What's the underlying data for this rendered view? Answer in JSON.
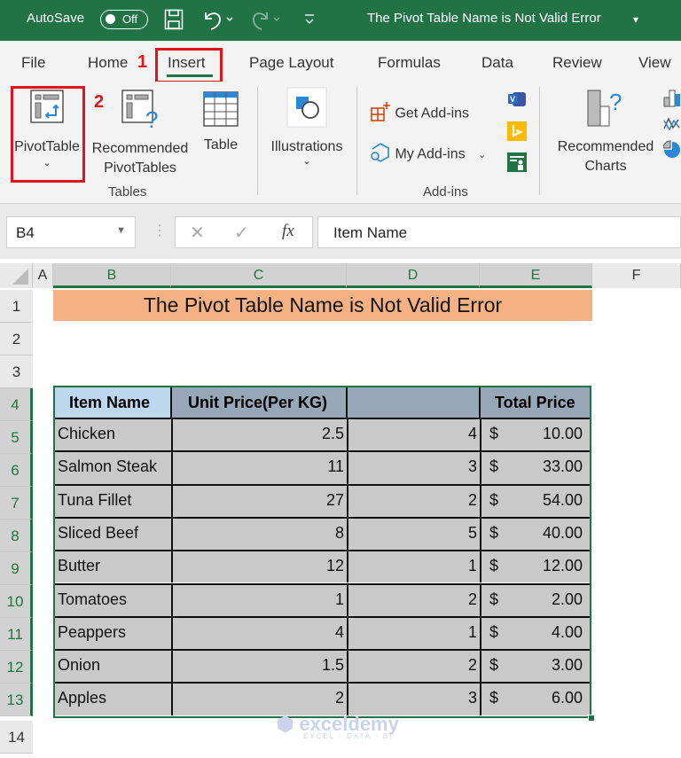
{
  "titlebar": {
    "autosave_label": "AutoSave",
    "autosave_state": "Off",
    "document_title": "The Pivot Table Name is Not Valid Error",
    "title_dropdown": "▾"
  },
  "ribbon_tabs": [
    "File",
    "Home",
    "Insert",
    "Page Layout",
    "Formulas",
    "Data",
    "Review",
    "View"
  ],
  "active_tab": "Insert",
  "annotations": {
    "step1": "1",
    "step2": "2"
  },
  "ribbon": {
    "pivot_table": "PivotTable",
    "recommended_pivot_line1": "Recommended",
    "recommended_pivot_line2": "PivotTables",
    "table": "Table",
    "tables_group": "Tables",
    "illustrations": "Illustrations",
    "get_addins": "Get Add-ins",
    "my_addins": "My Add-ins",
    "addins_group": "Add-ins",
    "recommended_charts_line1": "Recommended",
    "recommended_charts_line2": "Charts"
  },
  "formula_bar": {
    "name_box": "B4",
    "fx": "fx",
    "content": "Item Name"
  },
  "columns": [
    "A",
    "B",
    "C",
    "D",
    "E",
    "F"
  ],
  "rows": [
    "1",
    "2",
    "3",
    "4",
    "5",
    "6",
    "7",
    "8",
    "9",
    "10",
    "11",
    "12",
    "13",
    "14"
  ],
  "sheet": {
    "title": "The Pivot Table Name is Not Valid Error",
    "headers": [
      "Item Name",
      "Unit Price(Per KG)",
      "",
      "Total Price"
    ],
    "data": [
      {
        "item": "Chicken",
        "unit_price": "2.5",
        "qty": "4",
        "currency": "$",
        "total": "10.00"
      },
      {
        "item": "Salmon Steak",
        "unit_price": "11",
        "qty": "3",
        "currency": "$",
        "total": "33.00"
      },
      {
        "item": "Tuna Fillet",
        "unit_price": "27",
        "qty": "2",
        "currency": "$",
        "total": "54.00"
      },
      {
        "item": "Sliced Beef",
        "unit_price": "8",
        "qty": "5",
        "currency": "$",
        "total": "40.00"
      },
      {
        "item": "Butter",
        "unit_price": "12",
        "qty": "1",
        "currency": "$",
        "total": "12.00"
      },
      {
        "item": "Tomatoes",
        "unit_price": "1",
        "qty": "2",
        "currency": "$",
        "total": "2.00"
      },
      {
        "item": "Peappers",
        "unit_price": "4",
        "qty": "1",
        "currency": "$",
        "total": "4.00"
      },
      {
        "item": "Onion",
        "unit_price": "1.5",
        "qty": "2",
        "currency": "$",
        "total": "3.00"
      },
      {
        "item": "Apples",
        "unit_price": "2",
        "qty": "3",
        "currency": "$",
        "total": "6.00"
      }
    ]
  },
  "watermark": {
    "brand": "exceldemy",
    "tagline": "EXCEL · DATA · BI"
  },
  "colors": {
    "excel_green": "#217346",
    "title_fill": "#f4b183",
    "header_blue": "#bdd7ee",
    "header_gray": "#97a7b8",
    "data_fill": "#c9c9c9",
    "annotation_red": "#e0141e"
  }
}
